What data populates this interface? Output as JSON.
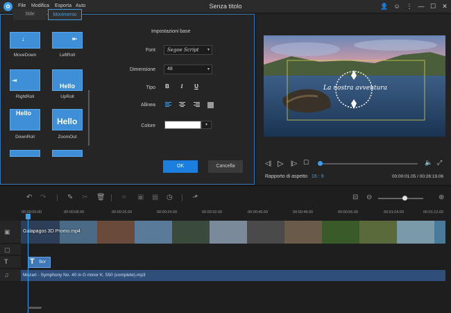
{
  "titlebar": {
    "menu": [
      "File",
      "Modifica",
      "Esporta",
      "Auto"
    ],
    "title": "Senza titolo"
  },
  "tabs": {
    "stile": "Stile",
    "movimento": "Movimento"
  },
  "thumbnails": [
    {
      "label": "MoveDown"
    },
    {
      "label": "LeftRoll"
    },
    {
      "label": "RightRoll"
    },
    {
      "label": "UpRoll"
    },
    {
      "label": "DownRoll"
    },
    {
      "label": "ZoomOut"
    }
  ],
  "thumb_glyph_text": "Hello",
  "settings": {
    "title": "Impostazioni base",
    "font_label": "Font",
    "font_value": "Segoe Script",
    "size_label": "Dimensione",
    "size_value": "48",
    "type_label": "Tipo",
    "bold": "B",
    "italic": "I",
    "underline": "U",
    "align_label": "Allinea",
    "color_label": "Colore",
    "color_value": "#ffffff",
    "ok": "OK",
    "cancel": "Cancella"
  },
  "preview": {
    "overlay_text": "La nostra avventura",
    "aspect_label": "Rapporto di aspetto",
    "aspect_value": "16 : 9",
    "time": "00:00:01.05 / 00:26:19.06",
    "progress_fraction": 0.0
  },
  "timeline": {
    "ticks": [
      "00:00:00.00",
      "00:00:08.00",
      "00:00:16.00",
      "00:00:24.00",
      "00:00:32.00",
      "00:00:40.00",
      "00:00:48.00",
      "00:00:56.00",
      "00:01:04.00",
      "00:01:12.00"
    ],
    "video_clip": "Galapagos 3D Promo.mp4",
    "text_clip": "Scr",
    "audio_clip": "Mozart - Symphony No. 40 in G minor K. 550 (complete).mp3"
  },
  "colors": {
    "accent": "#3aa0f0",
    "ok_button": "#1c7fe0",
    "audio_track": "#2f4f7a",
    "text_clip": "#3f78b8"
  }
}
